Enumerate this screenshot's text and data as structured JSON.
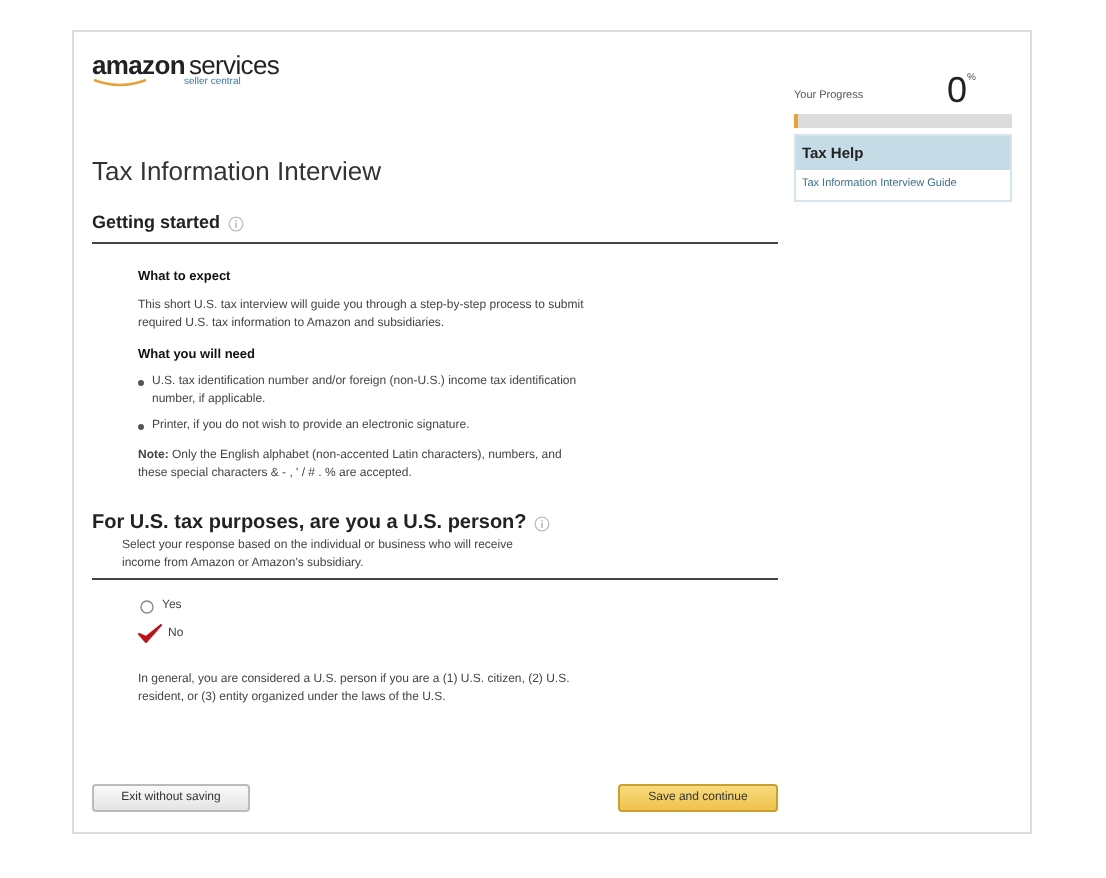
{
  "logo": {
    "brand": "amazon",
    "product": "services",
    "tagline": "seller central"
  },
  "progress": {
    "label": "Your Progress",
    "value": "0",
    "unit": "%",
    "level": 0.02
  },
  "help": {
    "title": "Tax Help",
    "links": [
      "Tax Information Interview Guide"
    ]
  },
  "title": "Tax Information Interview",
  "section": {
    "heading": "Getting started",
    "blocks": [
      {
        "kind": "heading",
        "text": "What to expect"
      },
      {
        "kind": "paragraph",
        "text": "This short U.S. tax interview will guide you through a step-by-step process to submit required U.S. tax information to Amazon and subsidiaries."
      },
      {
        "kind": "heading",
        "text": "What you will need"
      },
      {
        "kind": "bullets",
        "items": [
          "U.S. tax identification number and/or foreign (non-U.S.) income tax identification number, if applicable.",
          "Printer, if you do not wish to provide an electronic signature."
        ]
      },
      {
        "kind": "paragraph",
        "text": "**Note:** Only the English alphabet (non-accented Latin characters), numbers, and these special characters & - , ' / # . % are accepted."
      }
    ]
  },
  "question": {
    "heading": "For U.S. tax purposes, are you a U.S. person?",
    "hint": "Select your response based on the individual or business who will receive income from Amazon or Amazon's subsidiary.",
    "options": [
      {
        "label": "Yes",
        "selected": false
      },
      {
        "label": "No",
        "selected": true
      }
    ],
    "note": "In general, you are considered a U.S. person if you are a (1) U.S. citizen, (2) U.S. resident, or (3) entity organized under the laws of the U.S."
  },
  "buttons": [
    {
      "kind": "secondary",
      "label": "Exit without saving"
    },
    {
      "kind": "primary",
      "label": "Save and continue"
    }
  ]
}
